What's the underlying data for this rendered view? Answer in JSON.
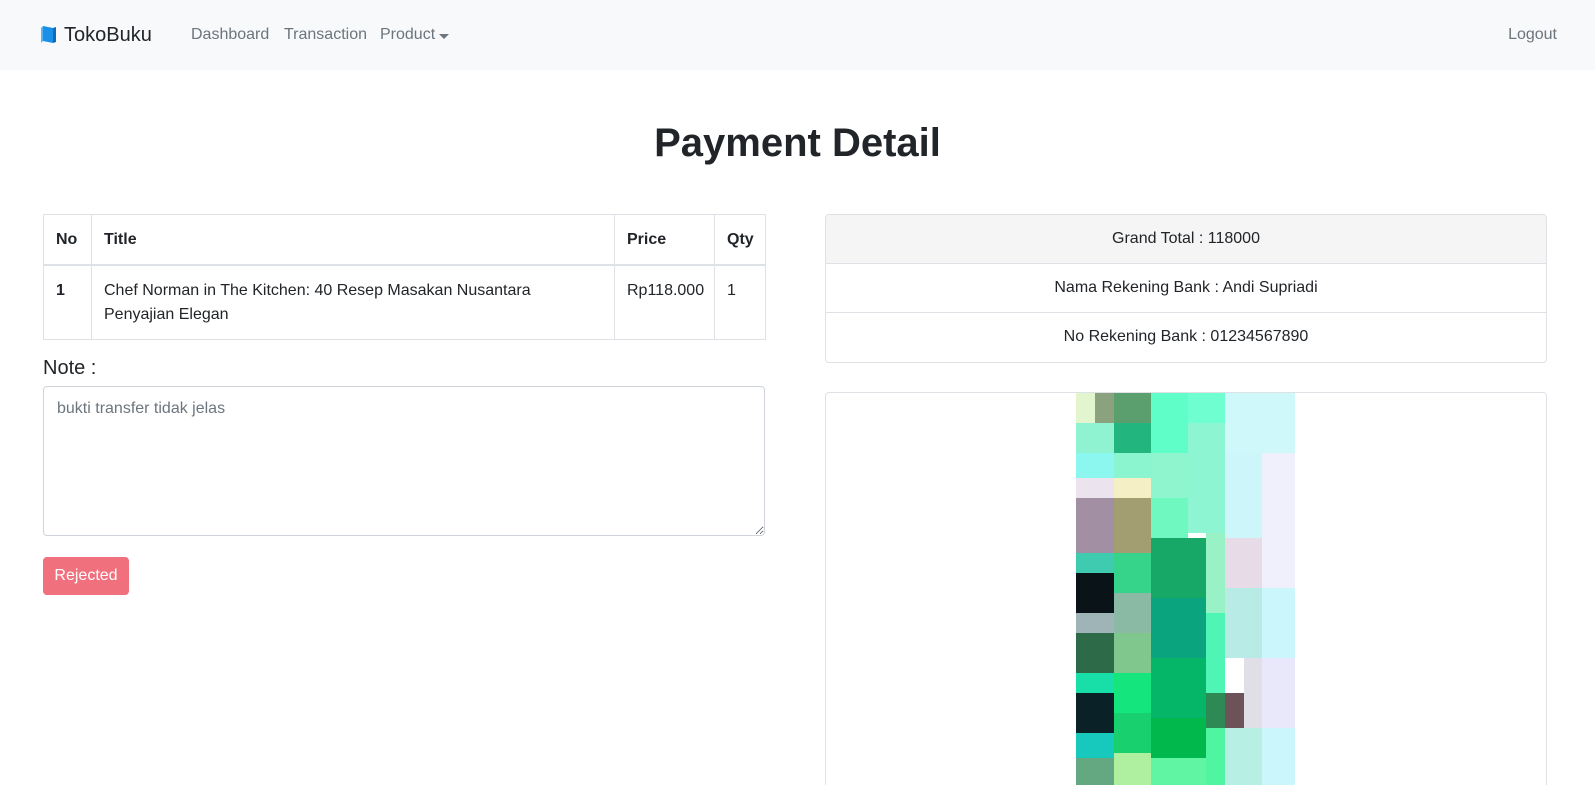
{
  "navbar": {
    "brand": "TokoBuku",
    "links": {
      "dashboard": "Dashboard",
      "transaction": "Transaction",
      "product": "Product"
    },
    "logout": "Logout"
  },
  "page": {
    "title": "Payment Detail"
  },
  "items_table": {
    "headers": {
      "no": "No",
      "title": "Title",
      "price": "Price",
      "qty": "Qty"
    },
    "rows": [
      {
        "no": "1",
        "title": "Chef Norman in The Kitchen: 40 Resep Masakan Nusantara Penyajian Elegan",
        "price": "Rp118.000",
        "qty": "1"
      }
    ]
  },
  "note": {
    "label": "Note :",
    "value": "bukti transfer tidak jelas"
  },
  "status_button": {
    "label": "Rejected",
    "color": "#f0707d"
  },
  "payment_info": {
    "grand_total": "Grand Total : 118000",
    "bank_account_name": "Nama Rekening Bank : Andi Supriadi",
    "bank_account_number": "No Rekening Bank : 01234567890"
  },
  "proof_image": {
    "icon": "payment-proof-image"
  },
  "colors": {
    "navbar_bg": "#f8f9fa",
    "brand_icon": "#1a8fe8",
    "danger_button": "#f0707d"
  }
}
